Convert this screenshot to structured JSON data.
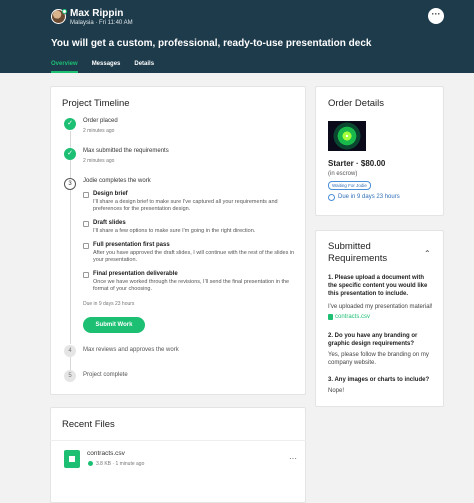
{
  "header": {
    "user_name": "Max Rippin",
    "user_meta": "Malaysia · Fri 11:40 AM",
    "more_label": "···",
    "order_title": "You will get a custom, professional, ready-to-use presentation deck",
    "tabs": [
      {
        "label": "Overview",
        "active": true
      },
      {
        "label": "Messages",
        "active": false
      },
      {
        "label": "Details",
        "active": false
      }
    ]
  },
  "timeline": {
    "title": "Project Timeline",
    "steps": [
      {
        "label": "Order placed",
        "time": "2 minutes ago",
        "state": "done",
        "marker": "✓"
      },
      {
        "label": "Max submitted the requirements",
        "time": "2 minutes ago",
        "state": "done",
        "marker": "✓"
      },
      {
        "label": "Jodie completes the work",
        "state": "current",
        "marker": "3"
      },
      {
        "label": "Max reviews and approves the work",
        "state": "todo",
        "marker": "4"
      },
      {
        "label": "Project complete",
        "state": "todo",
        "marker": "5"
      }
    ],
    "tasks": [
      {
        "title": "Design brief",
        "desc": "I'll share a design brief to make sure I've captured all your requirements and preferences for the presentation design."
      },
      {
        "title": "Draft slides",
        "desc": "I'll share a few options to make sure I'm going in the right direction."
      },
      {
        "title": "Full presentation first pass",
        "desc": "After you have approved the draft slides, I will continue with the rest of the slides in your presentation."
      },
      {
        "title": "Final presentation deliverable",
        "desc": "Once we have worked through the revisions, I'll send the final presentation in the format of your choosing."
      }
    ],
    "due_text": "Due in 9 days 23 hours",
    "submit_label": "Submit Work"
  },
  "order": {
    "title": "Order Details",
    "package": "Starter · $80.00",
    "escrow": "(in escrow)",
    "badge": "Waiting For Jodie",
    "due": "Due in 9 days 23 hours"
  },
  "requirements": {
    "title": "Submitted Requirements",
    "q1": "1. Please upload a document with the specific content you would like this presentation to include.",
    "a1": "I've uploaded my presentation material!",
    "a1_file": "contracts.csv",
    "q2": "2. Do you have any branding or graphic design requirements?",
    "a2": "Yes, please follow the branding on my company website.",
    "q3": "3. Any images or charts to include?",
    "a3": "Nope!"
  },
  "files": {
    "title": "Recent Files",
    "items": [
      {
        "name": "contracts.csv",
        "meta": "3.8 KB · 1 minute ago"
      }
    ]
  },
  "colors": {
    "header_bg": "#1e3b4b",
    "accent_green": "#1dbf73",
    "info_blue": "#2f6fb8"
  }
}
